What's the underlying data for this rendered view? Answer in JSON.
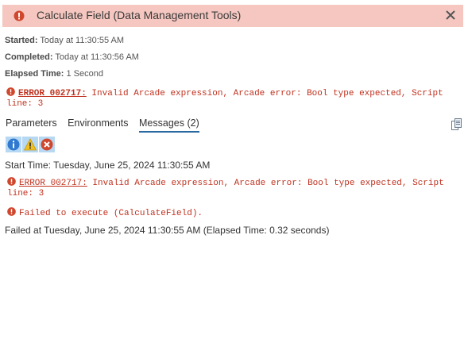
{
  "header": {
    "title": "Calculate Field (Data Management Tools)",
    "icon": "error-icon",
    "close_icon": "close-icon",
    "background": "#f5c7c0"
  },
  "summary": {
    "started_label": "Started:",
    "started_value": "Today at 11:30:55 AM",
    "completed_label": "Completed:",
    "completed_value": "Today at 11:30:56 AM",
    "elapsed_label": "Elapsed Time:",
    "elapsed_value": "1 Second",
    "error_code": "ERROR 002717:",
    "error_text": " Invalid Arcade expression, Arcade error: Bool type expected, Script line: 3"
  },
  "tabs": [
    {
      "label": "Parameters",
      "active": false
    },
    {
      "label": "Environments",
      "active": false
    },
    {
      "label": "Messages (2)",
      "active": true
    }
  ],
  "filters": [
    {
      "name": "info-filter",
      "icon": "info-icon"
    },
    {
      "name": "warning-filter",
      "icon": "warning-icon"
    },
    {
      "name": "error-filter",
      "icon": "error-icon"
    }
  ],
  "messages": {
    "start_time": "Start Time: Tuesday, June 25, 2024 11:30:55 AM",
    "error_code": "ERROR 002717:",
    "error_text": " Invalid Arcade expression, Arcade error: Bool type expected, Script line: 3",
    "failed_execute": "Failed to execute (CalculateField).",
    "failed_at": "Failed at Tuesday, June 25, 2024 11:30:55 AM (Elapsed Time: 0.32 seconds)"
  },
  "colors": {
    "error_text": "#c0321f",
    "error_icon": "#d0472e",
    "tab_underline": "#2a6aa0",
    "filter_bg": "#b6d8f2"
  }
}
